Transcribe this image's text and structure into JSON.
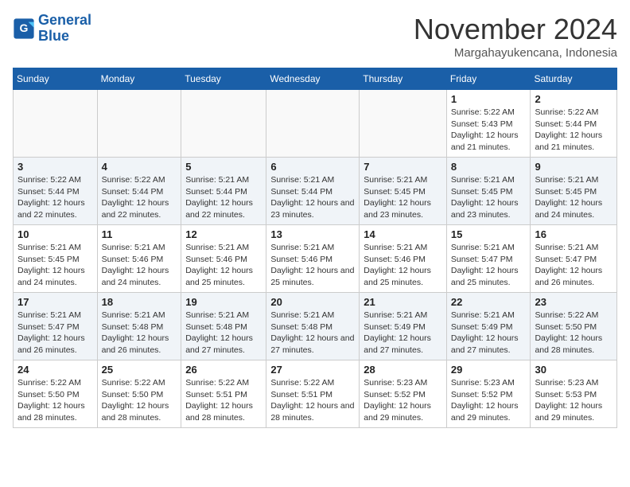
{
  "header": {
    "logo_line1": "General",
    "logo_line2": "Blue",
    "month_title": "November 2024",
    "location": "Margahayukencana, Indonesia"
  },
  "weekdays": [
    "Sunday",
    "Monday",
    "Tuesday",
    "Wednesday",
    "Thursday",
    "Friday",
    "Saturday"
  ],
  "weeks": [
    [
      {
        "day": "",
        "empty": true
      },
      {
        "day": "",
        "empty": true
      },
      {
        "day": "",
        "empty": true
      },
      {
        "day": "",
        "empty": true
      },
      {
        "day": "",
        "empty": true
      },
      {
        "day": "1",
        "sunrise": "5:22 AM",
        "sunset": "5:43 PM",
        "daylight": "12 hours and 21 minutes."
      },
      {
        "day": "2",
        "sunrise": "5:22 AM",
        "sunset": "5:44 PM",
        "daylight": "12 hours and 21 minutes."
      }
    ],
    [
      {
        "day": "3",
        "sunrise": "5:22 AM",
        "sunset": "5:44 PM",
        "daylight": "12 hours and 22 minutes."
      },
      {
        "day": "4",
        "sunrise": "5:22 AM",
        "sunset": "5:44 PM",
        "daylight": "12 hours and 22 minutes."
      },
      {
        "day": "5",
        "sunrise": "5:21 AM",
        "sunset": "5:44 PM",
        "daylight": "12 hours and 22 minutes."
      },
      {
        "day": "6",
        "sunrise": "5:21 AM",
        "sunset": "5:44 PM",
        "daylight": "12 hours and 23 minutes."
      },
      {
        "day": "7",
        "sunrise": "5:21 AM",
        "sunset": "5:45 PM",
        "daylight": "12 hours and 23 minutes."
      },
      {
        "day": "8",
        "sunrise": "5:21 AM",
        "sunset": "5:45 PM",
        "daylight": "12 hours and 23 minutes."
      },
      {
        "day": "9",
        "sunrise": "5:21 AM",
        "sunset": "5:45 PM",
        "daylight": "12 hours and 24 minutes."
      }
    ],
    [
      {
        "day": "10",
        "sunrise": "5:21 AM",
        "sunset": "5:45 PM",
        "daylight": "12 hours and 24 minutes."
      },
      {
        "day": "11",
        "sunrise": "5:21 AM",
        "sunset": "5:46 PM",
        "daylight": "12 hours and 24 minutes."
      },
      {
        "day": "12",
        "sunrise": "5:21 AM",
        "sunset": "5:46 PM",
        "daylight": "12 hours and 25 minutes."
      },
      {
        "day": "13",
        "sunrise": "5:21 AM",
        "sunset": "5:46 PM",
        "daylight": "12 hours and 25 minutes."
      },
      {
        "day": "14",
        "sunrise": "5:21 AM",
        "sunset": "5:46 PM",
        "daylight": "12 hours and 25 minutes."
      },
      {
        "day": "15",
        "sunrise": "5:21 AM",
        "sunset": "5:47 PM",
        "daylight": "12 hours and 25 minutes."
      },
      {
        "day": "16",
        "sunrise": "5:21 AM",
        "sunset": "5:47 PM",
        "daylight": "12 hours and 26 minutes."
      }
    ],
    [
      {
        "day": "17",
        "sunrise": "5:21 AM",
        "sunset": "5:47 PM",
        "daylight": "12 hours and 26 minutes."
      },
      {
        "day": "18",
        "sunrise": "5:21 AM",
        "sunset": "5:48 PM",
        "daylight": "12 hours and 26 minutes."
      },
      {
        "day": "19",
        "sunrise": "5:21 AM",
        "sunset": "5:48 PM",
        "daylight": "12 hours and 27 minutes."
      },
      {
        "day": "20",
        "sunrise": "5:21 AM",
        "sunset": "5:48 PM",
        "daylight": "12 hours and 27 minutes."
      },
      {
        "day": "21",
        "sunrise": "5:21 AM",
        "sunset": "5:49 PM",
        "daylight": "12 hours and 27 minutes."
      },
      {
        "day": "22",
        "sunrise": "5:21 AM",
        "sunset": "5:49 PM",
        "daylight": "12 hours and 27 minutes."
      },
      {
        "day": "23",
        "sunrise": "5:22 AM",
        "sunset": "5:50 PM",
        "daylight": "12 hours and 28 minutes."
      }
    ],
    [
      {
        "day": "24",
        "sunrise": "5:22 AM",
        "sunset": "5:50 PM",
        "daylight": "12 hours and 28 minutes."
      },
      {
        "day": "25",
        "sunrise": "5:22 AM",
        "sunset": "5:50 PM",
        "daylight": "12 hours and 28 minutes."
      },
      {
        "day": "26",
        "sunrise": "5:22 AM",
        "sunset": "5:51 PM",
        "daylight": "12 hours and 28 minutes."
      },
      {
        "day": "27",
        "sunrise": "5:22 AM",
        "sunset": "5:51 PM",
        "daylight": "12 hours and 28 minutes."
      },
      {
        "day": "28",
        "sunrise": "5:23 AM",
        "sunset": "5:52 PM",
        "daylight": "12 hours and 29 minutes."
      },
      {
        "day": "29",
        "sunrise": "5:23 AM",
        "sunset": "5:52 PM",
        "daylight": "12 hours and 29 minutes."
      },
      {
        "day": "30",
        "sunrise": "5:23 AM",
        "sunset": "5:53 PM",
        "daylight": "12 hours and 29 minutes."
      }
    ]
  ]
}
